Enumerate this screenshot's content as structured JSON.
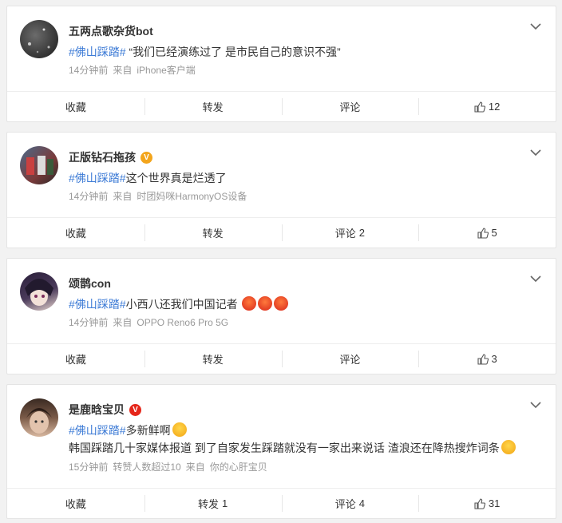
{
  "actions": {
    "collect": "收藏",
    "forward": "转发",
    "comment": "评论"
  },
  "posts": [
    {
      "username": "五两点歌杂货bot",
      "topic": "#佛山踩踏#",
      "text": " “我们已经演练过了 是市民自己的意识不强”",
      "extra": "",
      "time": "14分钟前",
      "source_prefix": "来自",
      "source": "iPhone客户端",
      "forward_count": "",
      "comment_count": "",
      "like_count": "12",
      "badge": ""
    },
    {
      "username": "正版钻石拖孩",
      "topic": "#佛山踩踏#",
      "text": "这个世界真是烂透了",
      "extra": "",
      "time": "14分钟前",
      "source_prefix": "来自",
      "source": "时团妈咪HarmonyOS设备",
      "forward_count": "",
      "comment_count": "2",
      "like_count": "5",
      "badge": "V"
    },
    {
      "username": "颂鹊con",
      "topic": "#佛山踩踏#",
      "text": "小西八还我们中国记者",
      "extra": "",
      "time": "14分钟前",
      "source_prefix": "来自",
      "source": "OPPO Reno6 Pro 5G",
      "forward_count": "",
      "comment_count": "",
      "like_count": "3",
      "badge": ""
    },
    {
      "username": "是鹿晗宝贝",
      "topic": "#佛山踩踏#",
      "text": "多新鲜啊",
      "extra": "韩国踩踏几十家媒体报道 到了自家发生踩踏就没有一家出来说话 渣浪还在降热搜炸词条",
      "time": "15分钟前",
      "forward_note": "转赞人数超过10",
      "source_prefix": "来自",
      "source": "你的心肝宝贝",
      "forward_count": "1",
      "comment_count": "4",
      "like_count": "31",
      "badge": "V"
    }
  ]
}
